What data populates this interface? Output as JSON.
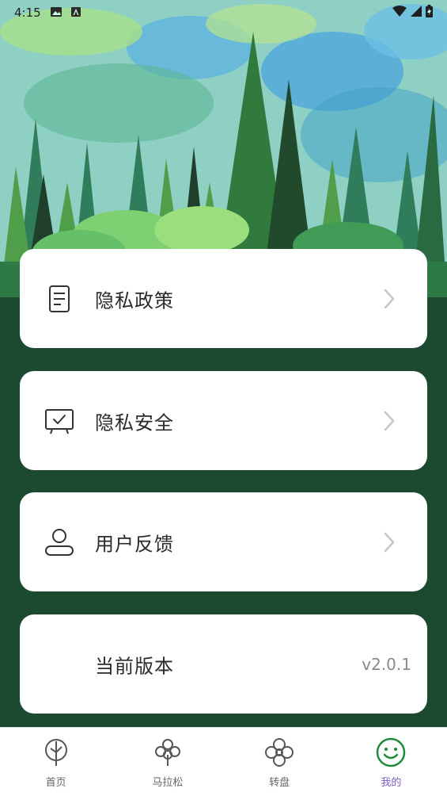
{
  "status_bar": {
    "time": "4:15"
  },
  "menu": [
    {
      "label": "隐私政策",
      "icon": "document-icon"
    },
    {
      "label": "隐私安全",
      "icon": "monitor-check-icon"
    },
    {
      "label": "用户反馈",
      "icon": "user-icon"
    },
    {
      "label": "当前版本",
      "value": "v2.0.1"
    }
  ],
  "bottom_nav": [
    {
      "label": "首页",
      "icon": "tree-icon",
      "active": false
    },
    {
      "label": "马拉松",
      "icon": "clover-tree-icon",
      "active": false
    },
    {
      "label": "转盘",
      "icon": "flower-wheel-icon",
      "active": false
    },
    {
      "label": "我的",
      "icon": "smiley-icon",
      "active": true
    }
  ],
  "colors": {
    "background": "#1b4a30",
    "card": "#ffffff",
    "active_nav_icon": "#1f8a3b",
    "active_nav_label": "#7a5cc9"
  }
}
